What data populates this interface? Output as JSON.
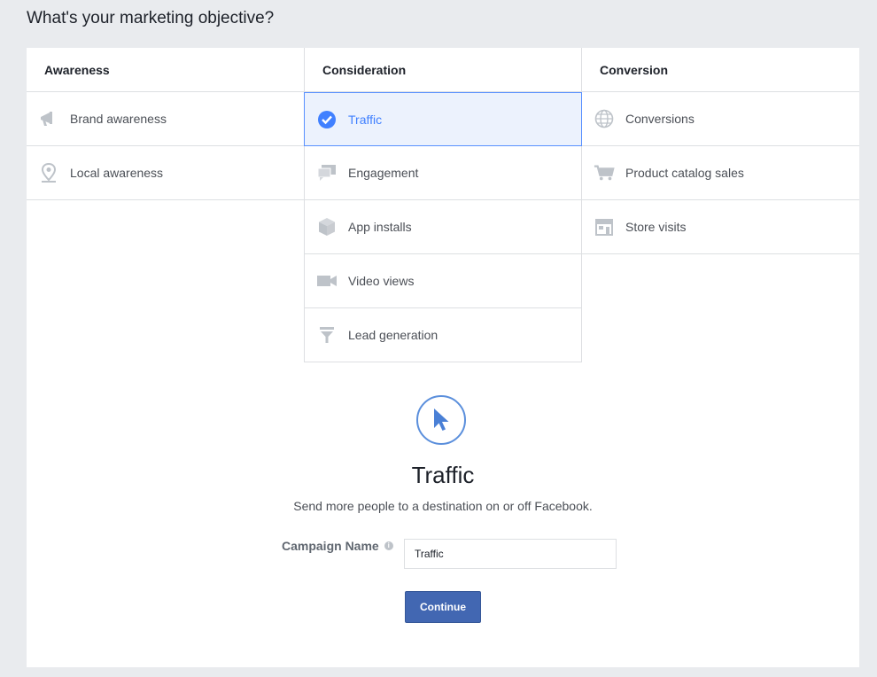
{
  "page": {
    "title": "What's your marketing objective?"
  },
  "columns": [
    {
      "heading": "Awareness",
      "options": [
        {
          "label": "Brand awareness",
          "icon": "megaphone-icon"
        },
        {
          "label": "Local awareness",
          "icon": "map-pin-icon"
        }
      ]
    },
    {
      "heading": "Consideration",
      "options": [
        {
          "label": "Traffic",
          "icon": "check-circle-icon",
          "selected": true
        },
        {
          "label": "Engagement",
          "icon": "chat-bubbles-icon"
        },
        {
          "label": "App installs",
          "icon": "box-icon"
        },
        {
          "label": "Video views",
          "icon": "video-camera-icon"
        },
        {
          "label": "Lead generation",
          "icon": "funnel-icon"
        }
      ]
    },
    {
      "heading": "Conversion",
      "options": [
        {
          "label": "Conversions",
          "icon": "globe-icon"
        },
        {
          "label": "Product catalog sales",
          "icon": "shopping-cart-icon"
        },
        {
          "label": "Store visits",
          "icon": "storefront-icon"
        }
      ]
    }
  ],
  "detail": {
    "icon": "cursor-icon",
    "title": "Traffic",
    "description": "Send more people to a destination on or off Facebook."
  },
  "form": {
    "campaign_label": "Campaign Name",
    "info_glyph": "i",
    "campaign_value": "Traffic",
    "continue_label": "Continue"
  },
  "colors": {
    "accent": "#4080ff",
    "button": "#4267b2",
    "icon_gray": "#bec3c9"
  }
}
